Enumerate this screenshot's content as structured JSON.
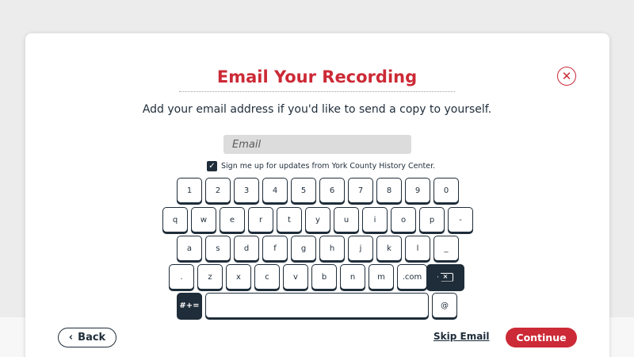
{
  "dialog": {
    "title": "Email Your Recording",
    "subtitle": "Add your email address if you'd like to send a copy to yourself.",
    "close_icon": "close-icon"
  },
  "email": {
    "placeholder": "Email",
    "value": ""
  },
  "updates": {
    "checked": true,
    "label": "Sign me up for updates from York County History Center."
  },
  "keyboard": {
    "row1": [
      "1",
      "2",
      "3",
      "4",
      "5",
      "6",
      "7",
      "8",
      "9",
      "0"
    ],
    "row2": [
      "q",
      "w",
      "e",
      "r",
      "t",
      "y",
      "u",
      "i",
      "o",
      "p",
      "-"
    ],
    "row3": [
      "a",
      "s",
      "d",
      "f",
      "g",
      "h",
      "j",
      "k",
      "l",
      "_"
    ],
    "row4": [
      ".",
      "z",
      "x",
      "c",
      "v",
      "b",
      "n",
      "m",
      ".com"
    ],
    "backspace_icon": "backspace-icon",
    "symbols_label": "#+=",
    "at_label": "@"
  },
  "footer": {
    "back_label": "Back",
    "back_icon": "chevron-left-icon",
    "skip_label": "Skip Email",
    "continue_label": "Continue"
  },
  "colors": {
    "accent": "#cc2a36",
    "navy": "#1f2d3a",
    "input_bg": "#dcdcdc"
  }
}
